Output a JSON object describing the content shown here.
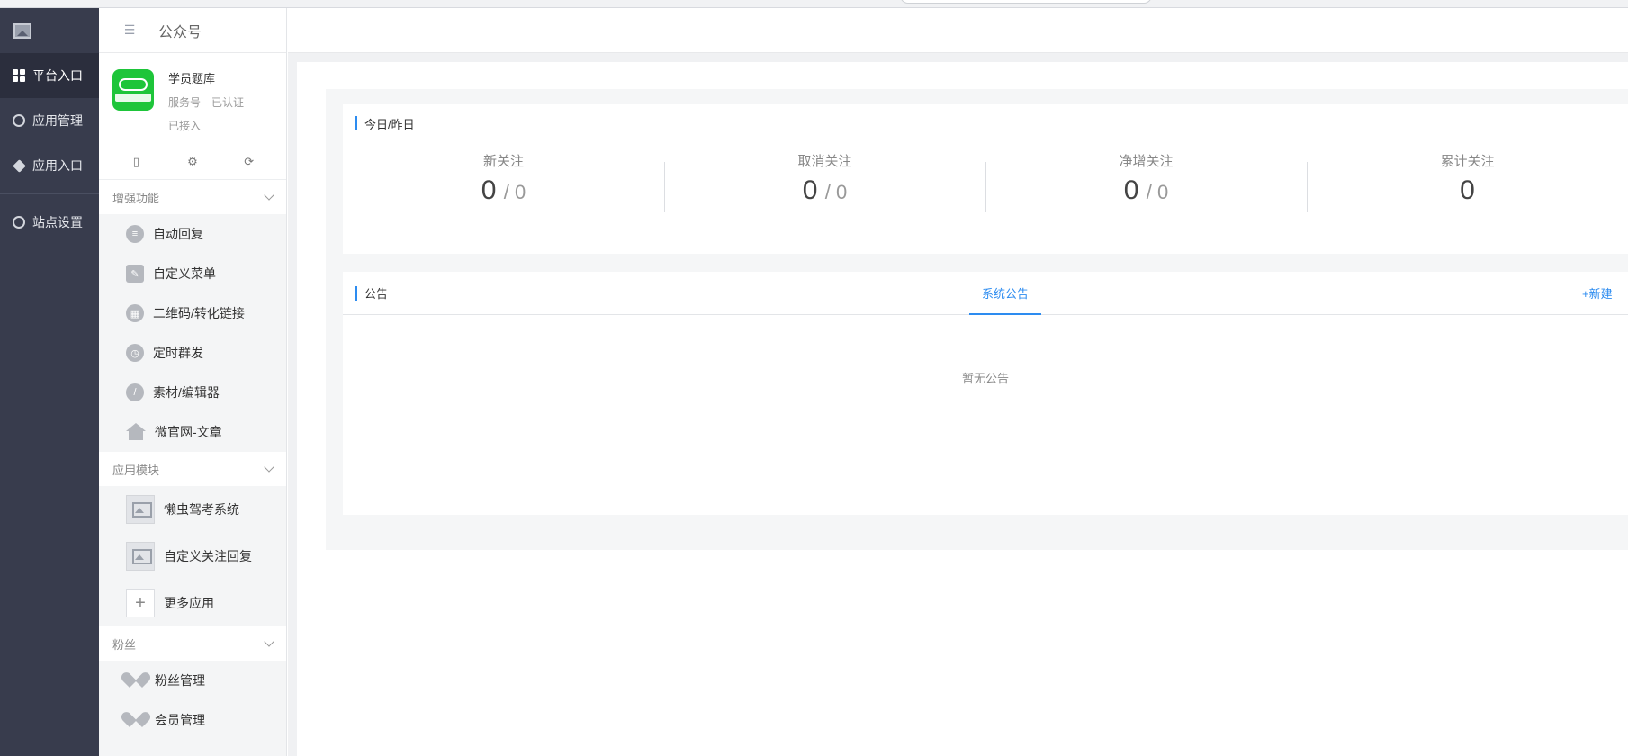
{
  "rail": {
    "items": [
      {
        "label": "平台入口",
        "icon": "grid-icon",
        "active": true
      },
      {
        "label": "应用管理",
        "icon": "app-manage-icon"
      },
      {
        "label": "应用入口",
        "icon": "cube-icon"
      },
      {
        "label": "站点设置",
        "icon": "globe-icon"
      }
    ]
  },
  "panel": {
    "title": "公众号",
    "account": {
      "name": "学员题库",
      "type": "服务号",
      "verified": "已认证",
      "status": "已接入"
    },
    "sections": {
      "enhance": "增强功能",
      "modules": "应用模块",
      "fans": "粉丝"
    },
    "enhance_items": [
      "自动回复",
      "自定义菜单",
      "二维码/转化链接",
      "定时群发",
      "素材/编辑器",
      "微官网-文章"
    ],
    "module_items": [
      "懒虫驾考系统",
      "自定义关注回复"
    ],
    "more_apps": "更多应用",
    "fans_items": [
      "粉丝管理",
      "会员管理"
    ]
  },
  "stats": {
    "title": "今日/昨日",
    "items": [
      {
        "label": "新关注",
        "today": "0",
        "yesterday": "/ 0"
      },
      {
        "label": "取消关注",
        "today": "0",
        "yesterday": "/ 0"
      },
      {
        "label": "净增关注",
        "today": "0",
        "yesterday": "/ 0"
      },
      {
        "label": "累计关注",
        "today": "0",
        "yesterday": ""
      }
    ]
  },
  "notice": {
    "title": "公告",
    "tab": "系统公告",
    "new_link": "+新建",
    "empty": "暂无公告"
  },
  "colors": {
    "rail_bg": "#383c4d",
    "accent": "#2d8cf0",
    "avatar_green": "#1ec53a"
  }
}
